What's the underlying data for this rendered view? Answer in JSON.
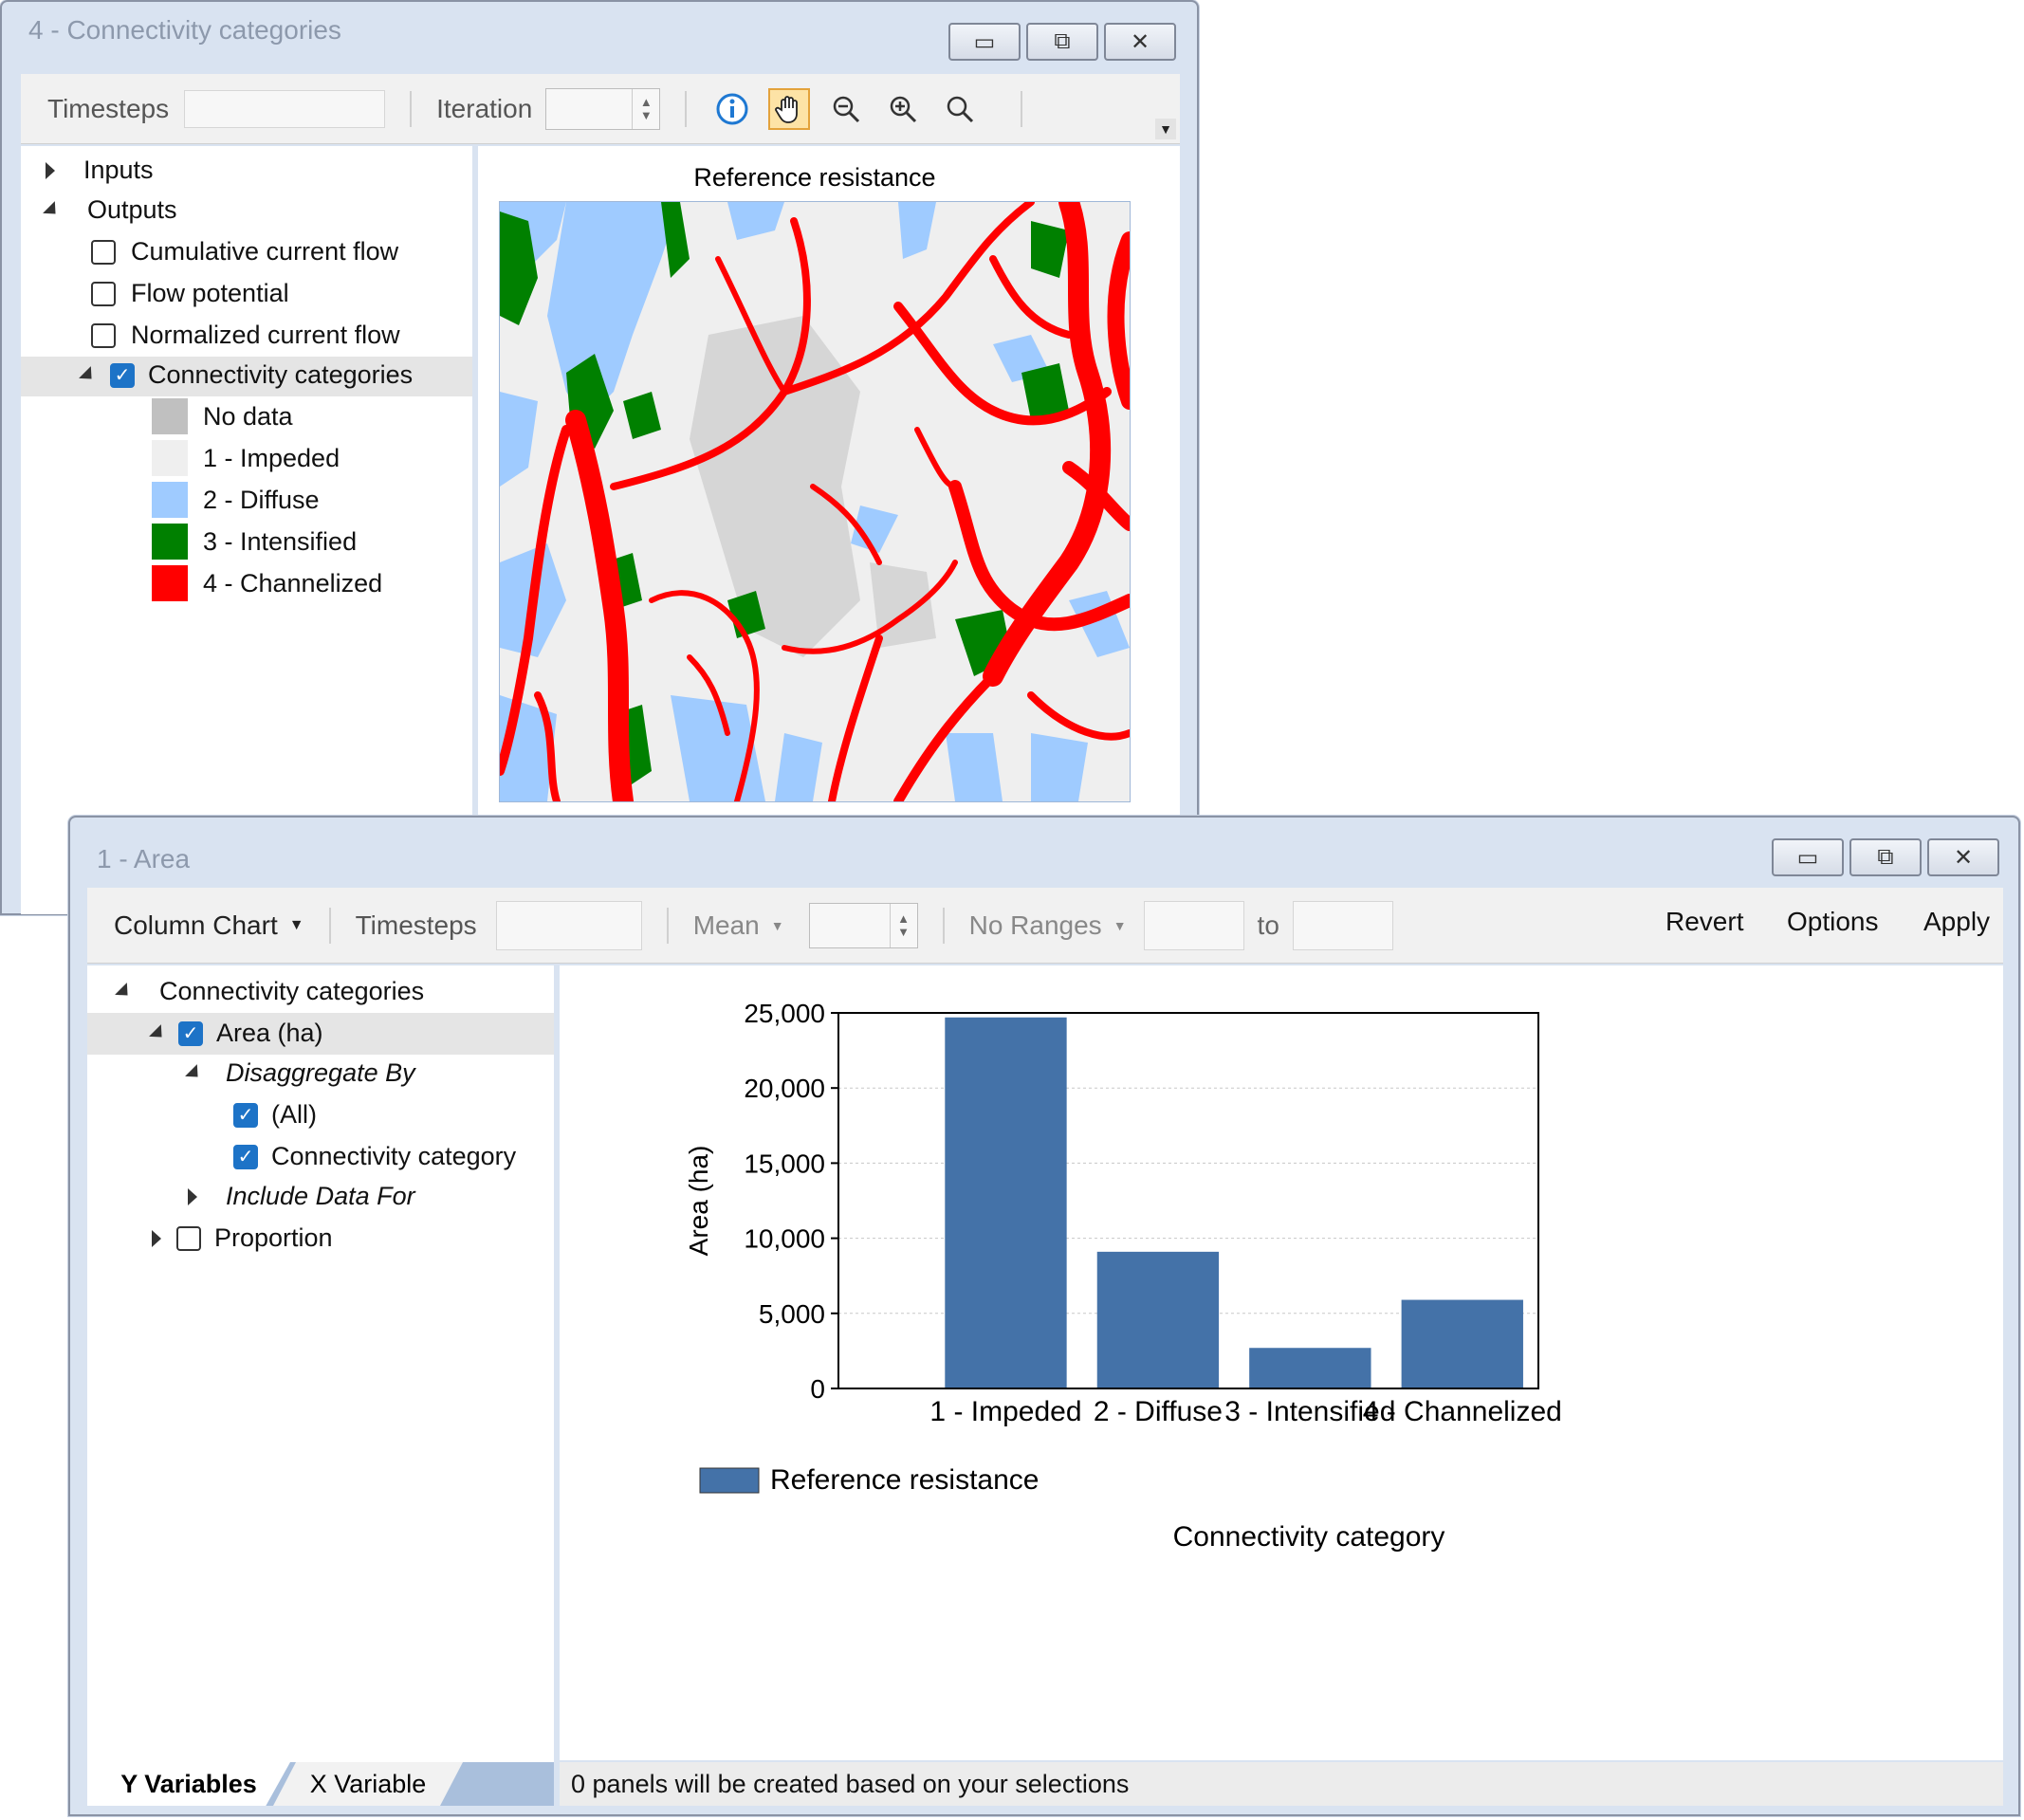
{
  "map_window": {
    "title": "4 - Connectivity categories",
    "toolbar": {
      "timesteps_label": "Timesteps",
      "timesteps_value": "",
      "iteration_label": "Iteration",
      "iteration_value": "",
      "tools": [
        "info-icon",
        "pan-hand-icon",
        "zoom-out-icon",
        "zoom-in-icon",
        "zoom-extent-icon"
      ]
    },
    "tree": {
      "inputs": "Inputs",
      "outputs": "Outputs",
      "cumulative_current_flow": "Cumulative current flow",
      "flow_potential": "Flow potential",
      "normalized_current_flow": "Normalized current flow",
      "connectivity_categories": "Connectivity categories",
      "legend": [
        {
          "label": "No data",
          "color": "#c0c0c0"
        },
        {
          "label": "1 - Impeded",
          "color": "#efefef"
        },
        {
          "label": "2 - Diffuse",
          "color": "#9fcbff"
        },
        {
          "label": "3 - Intensified",
          "color": "#008000"
        },
        {
          "label": "4 - Channelized",
          "color": "#ff0000"
        }
      ]
    },
    "map_title": "Reference resistance"
  },
  "area_window": {
    "title": "1 - Area",
    "toolbar": {
      "chart_type": "Column Chart",
      "timesteps_label": "Timesteps",
      "mean_label": "Mean",
      "no_ranges_label": "No Ranges",
      "to_label": "to",
      "revert": "Revert",
      "options": "Options",
      "apply": "Apply"
    },
    "tree": {
      "connectivity_categories": "Connectivity categories",
      "area": "Area (ha)",
      "disaggregate_by": "Disaggregate By",
      "all": "(All)",
      "connectivity_category": "Connectivity category",
      "include_data_for": "Include Data For",
      "proportion": "Proportion"
    },
    "tabs": {
      "y_variables": "Y Variables",
      "x_variable": "X Variable"
    },
    "status": "0 panels will be created based on your selections"
  },
  "chart_data": {
    "type": "bar",
    "categories": [
      "1 - Impeded",
      "2 - Diffuse",
      "3 - Intensified",
      "4 - Channelized"
    ],
    "series": [
      {
        "name": "Reference resistance",
        "values": [
          24700,
          9100,
          2700,
          5900
        ],
        "color": "#4472a8"
      }
    ],
    "ylabel": "Area (ha)",
    "xlabel": "Connectivity category",
    "ylim": [
      0,
      25000
    ],
    "yticks": [
      0,
      5000,
      10000,
      15000,
      20000,
      25000
    ],
    "ytick_labels": [
      "0",
      "5,000",
      "10,000",
      "15,000",
      "20,000",
      "25,000"
    ],
    "grid": true,
    "legend_position": "bottom-left"
  }
}
